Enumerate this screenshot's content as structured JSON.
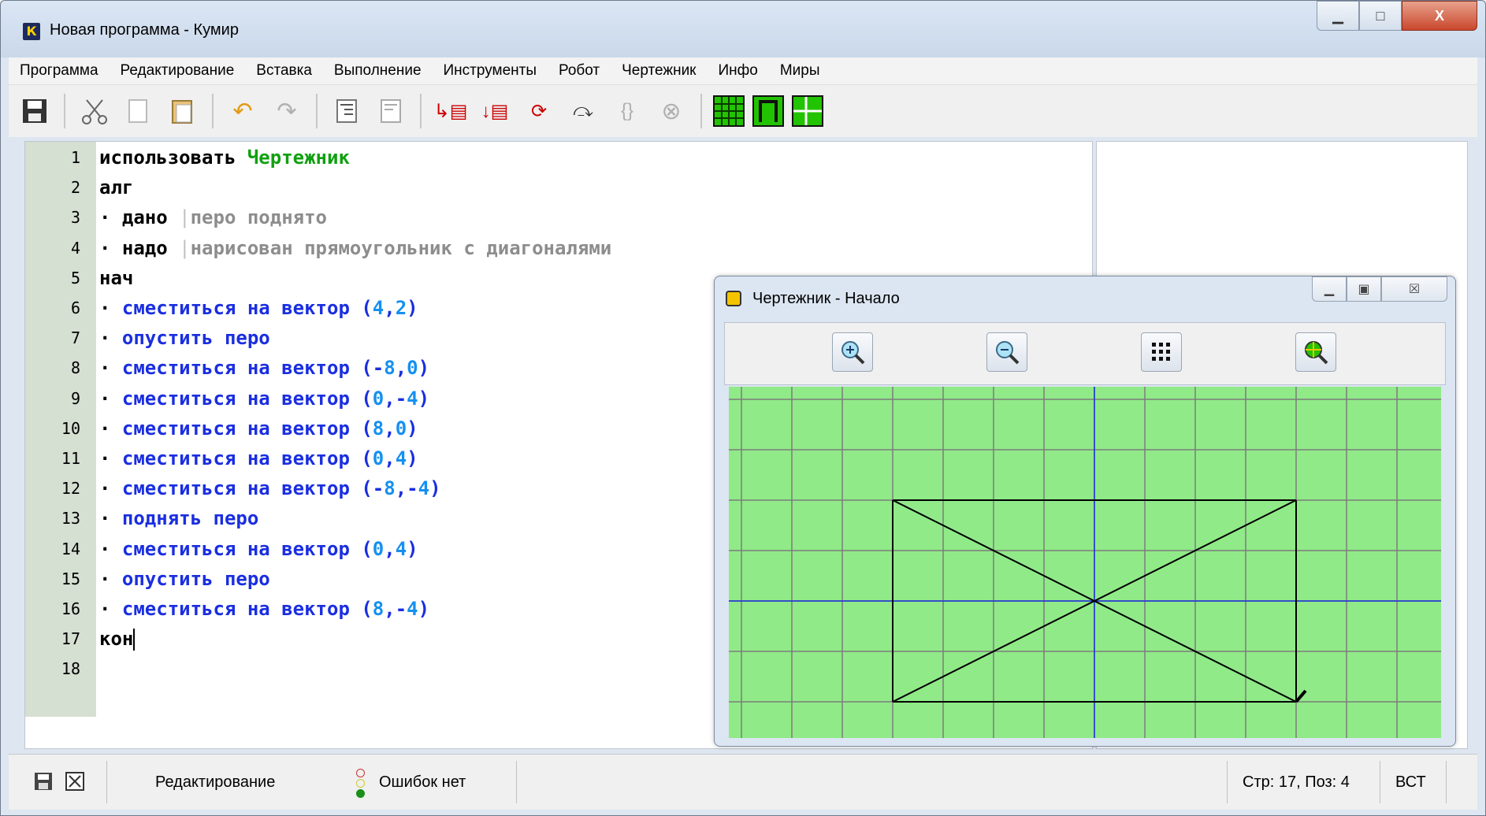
{
  "window": {
    "title": "Новая программа - Кумир",
    "app_icon_letter": "К",
    "controls": {
      "minimize": "▁",
      "maximize": "□",
      "close": "X"
    }
  },
  "menu": {
    "items": [
      "Программа",
      "Редактирование",
      "Вставка",
      "Выполнение",
      "Инструменты",
      "Робот",
      "Чертежник",
      "Инфо",
      "Миры"
    ]
  },
  "toolbar": {
    "icons": [
      "save-icon",
      "cut-icon",
      "copy-icon",
      "paste-icon",
      "undo-icon",
      "redo-icon",
      "indent-icon",
      "unindent-icon",
      "run-icon",
      "run-step-icon",
      "step-in-icon",
      "step-out-icon",
      "step-over-icon",
      "stop-icon",
      "grid-icon",
      "frame-icon",
      "axes-icon"
    ]
  },
  "editor": {
    "lines": [
      {
        "n": "1",
        "segments": [
          {
            "t": "использовать ",
            "c": "kw"
          },
          {
            "t": "Чертежник",
            "c": "green-t"
          }
        ]
      },
      {
        "n": "2",
        "segments": [
          {
            "t": "алг",
            "c": "kw"
          }
        ]
      },
      {
        "n": "3",
        "segments": [
          {
            "t": "· ",
            "c": "kw"
          },
          {
            "t": "дано ",
            "c": "kw"
          },
          {
            "t": "|",
            "c": "bar"
          },
          {
            "t": "перо поднято",
            "c": "comment"
          }
        ]
      },
      {
        "n": "4",
        "segments": [
          {
            "t": "· ",
            "c": "kw"
          },
          {
            "t": "надо ",
            "c": "kw"
          },
          {
            "t": "|",
            "c": "bar"
          },
          {
            "t": "нарисован прямоугольник с диагоналями",
            "c": "comment"
          }
        ]
      },
      {
        "n": "5",
        "segments": [
          {
            "t": "нач",
            "c": "kw"
          }
        ]
      },
      {
        "n": "6",
        "segments": [
          {
            "t": "· ",
            "c": "kw"
          },
          {
            "t": "сместиться на вектор ",
            "c": "blue-t"
          },
          {
            "t": "(",
            "c": "par"
          },
          {
            "t": "4",
            "c": "num"
          },
          {
            "t": ",",
            "c": "par"
          },
          {
            "t": "2",
            "c": "num"
          },
          {
            "t": ")",
            "c": "par"
          }
        ]
      },
      {
        "n": "7",
        "segments": [
          {
            "t": "· ",
            "c": "kw"
          },
          {
            "t": "опустить перо",
            "c": "blue-t"
          }
        ]
      },
      {
        "n": "8",
        "segments": [
          {
            "t": "· ",
            "c": "kw"
          },
          {
            "t": "сместиться на вектор ",
            "c": "blue-t"
          },
          {
            "t": "(-",
            "c": "par"
          },
          {
            "t": "8",
            "c": "num"
          },
          {
            "t": ",",
            "c": "par"
          },
          {
            "t": "0",
            "c": "num"
          },
          {
            "t": ")",
            "c": "par"
          }
        ]
      },
      {
        "n": "9",
        "segments": [
          {
            "t": "· ",
            "c": "kw"
          },
          {
            "t": "сместиться на вектор ",
            "c": "blue-t"
          },
          {
            "t": "(",
            "c": "par"
          },
          {
            "t": "0",
            "c": "num"
          },
          {
            "t": ",-",
            "c": "par"
          },
          {
            "t": "4",
            "c": "num"
          },
          {
            "t": ")",
            "c": "par"
          }
        ]
      },
      {
        "n": "10",
        "segments": [
          {
            "t": "· ",
            "c": "kw"
          },
          {
            "t": "сместиться на вектор ",
            "c": "blue-t"
          },
          {
            "t": "(",
            "c": "par"
          },
          {
            "t": "8",
            "c": "num"
          },
          {
            "t": ",",
            "c": "par"
          },
          {
            "t": "0",
            "c": "num"
          },
          {
            "t": ")",
            "c": "par"
          }
        ]
      },
      {
        "n": "11",
        "segments": [
          {
            "t": "· ",
            "c": "kw"
          },
          {
            "t": "сместиться на вектор ",
            "c": "blue-t"
          },
          {
            "t": "(",
            "c": "par"
          },
          {
            "t": "0",
            "c": "num"
          },
          {
            "t": ",",
            "c": "par"
          },
          {
            "t": "4",
            "c": "num"
          },
          {
            "t": ")",
            "c": "par"
          }
        ]
      },
      {
        "n": "12",
        "segments": [
          {
            "t": "· ",
            "c": "kw"
          },
          {
            "t": "сместиться на вектор ",
            "c": "blue-t"
          },
          {
            "t": "(-",
            "c": "par"
          },
          {
            "t": "8",
            "c": "num"
          },
          {
            "t": ",-",
            "c": "par"
          },
          {
            "t": "4",
            "c": "num"
          },
          {
            "t": ")",
            "c": "par"
          }
        ]
      },
      {
        "n": "13",
        "segments": [
          {
            "t": "· ",
            "c": "kw"
          },
          {
            "t": "поднять перо",
            "c": "blue-t"
          }
        ]
      },
      {
        "n": "14",
        "segments": [
          {
            "t": "· ",
            "c": "kw"
          },
          {
            "t": "сместиться на вектор ",
            "c": "blue-t"
          },
          {
            "t": "(",
            "c": "par"
          },
          {
            "t": "0",
            "c": "num"
          },
          {
            "t": ",",
            "c": "par"
          },
          {
            "t": "4",
            "c": "num"
          },
          {
            "t": ")",
            "c": "par"
          }
        ]
      },
      {
        "n": "15",
        "segments": [
          {
            "t": "· ",
            "c": "kw"
          },
          {
            "t": "опустить перо",
            "c": "blue-t"
          }
        ]
      },
      {
        "n": "16",
        "segments": [
          {
            "t": "· ",
            "c": "kw"
          },
          {
            "t": "сместиться на вектор ",
            "c": "blue-t"
          },
          {
            "t": "(",
            "c": "par"
          },
          {
            "t": "8",
            "c": "num"
          },
          {
            "t": ",-",
            "c": "par"
          },
          {
            "t": "4",
            "c": "num"
          },
          {
            "t": ")",
            "c": "par"
          }
        ]
      },
      {
        "n": "17",
        "segments": [
          {
            "t": "кон",
            "c": "kw"
          }
        ],
        "cursor": true
      },
      {
        "n": "18",
        "segments": []
      }
    ]
  },
  "status": {
    "mode": "Редактирование",
    "errors": "Ошибок нет",
    "position": "Стр: 17, Поз: 4",
    "insert_mode": "ВСТ",
    "traffic_colors": [
      "#f5f5f5",
      "#f5f5f5",
      "#1a8f1a"
    ]
  },
  "drawer": {
    "title": "Чертежник - Начало",
    "controls": {
      "minimize": "▁",
      "maximize": "▣",
      "close": "☒"
    },
    "buttons": [
      "zoom-in-icon",
      "zoom-out-icon",
      "grid-toggle-icon",
      "zoom-fit-icon"
    ],
    "colors": {
      "field": "#90ea88",
      "grid": "#7c7c7c",
      "axes": "#1a2ee0",
      "drawing": "#000000"
    },
    "scene": {
      "segments": [
        [
          [
            4,
            2
          ],
          [
            -4,
            2
          ]
        ],
        [
          [
            -4,
            2
          ],
          [
            -4,
            -2
          ]
        ],
        [
          [
            -4,
            -2
          ],
          [
            4,
            -2
          ]
        ],
        [
          [
            4,
            -2
          ],
          [
            4,
            2
          ]
        ],
        [
          [
            4,
            2
          ],
          [
            -4,
            -2
          ]
        ],
        [
          [
            -4,
            2
          ],
          [
            4,
            -2
          ]
        ]
      ],
      "pen_at": [
        4,
        -2
      ]
    }
  }
}
